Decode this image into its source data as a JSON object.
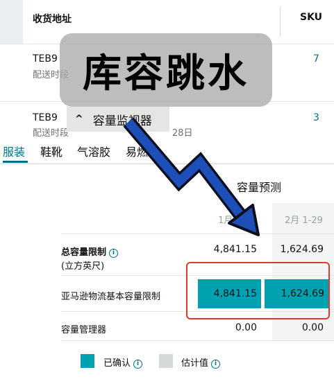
{
  "shipments": {
    "headers": {
      "address": "收货地址",
      "sku": "SKU"
    },
    "rows": [
      {
        "code": "TEB9",
        "sub": "配送时段",
        "sku": "7"
      },
      {
        "code": "TEB9",
        "sub": "配送时段",
        "date_tail": "28日",
        "sku": "3"
      }
    ]
  },
  "overlay": {
    "caption": "库容跳水"
  },
  "monitor": {
    "chevron": "^",
    "label": "容量监视器"
  },
  "tabs": [
    "服装",
    "鞋靴",
    "气溶胶",
    "易燃物"
  ],
  "forecast": {
    "title": "容量预测",
    "months": [
      "1月",
      "2月 1-29"
    ],
    "rows": [
      {
        "label": "总容量限制",
        "sub": "(立方英尺)",
        "values": [
          "4,841.15",
          "1,624.69"
        ]
      },
      {
        "label": "亚马逊物流基本容量限制",
        "values": [
          "4,841.15",
          "1,624.69"
        ]
      },
      {
        "label": "容量管理器",
        "values": [
          "0.00",
          "0.00"
        ]
      }
    ]
  },
  "legend": {
    "confirmed": {
      "label": "已确认",
      "color": "#00a1b1"
    },
    "estimated": {
      "label": "估计值",
      "color": "#d5d9d9"
    }
  },
  "colors": {
    "accent": "#007185",
    "bar": "#00a1b1",
    "highlight": "#e4382b",
    "arrow": "#1e4fb8"
  }
}
